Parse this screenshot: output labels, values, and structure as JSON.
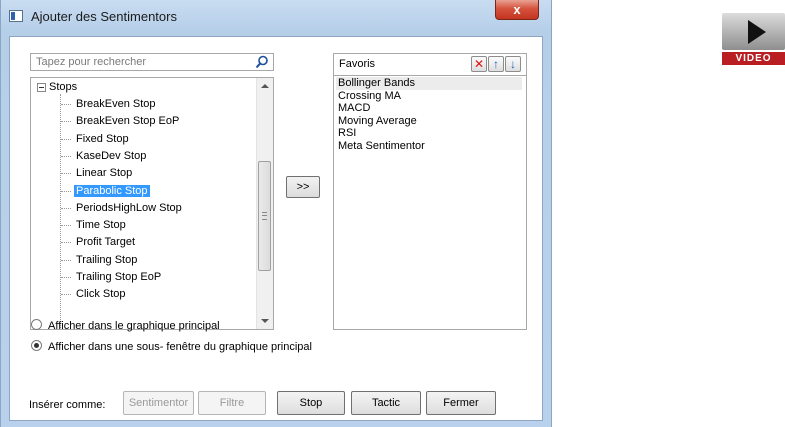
{
  "window": {
    "title": "Ajouter des Sentimentors",
    "close_label": "x"
  },
  "search": {
    "placeholder": "Tapez pour rechercher"
  },
  "tree": {
    "root_label": "Stops",
    "items": [
      {
        "label": "BreakEven Stop"
      },
      {
        "label": "BreakEven Stop EoP"
      },
      {
        "label": "Fixed Stop"
      },
      {
        "label": "KaseDev Stop"
      },
      {
        "label": "Linear Stop"
      },
      {
        "label": "Parabolic Stop",
        "selected": true
      },
      {
        "label": "PeriodsHighLow Stop"
      },
      {
        "label": "Time Stop"
      },
      {
        "label": "Profit Target"
      },
      {
        "label": "Trailing Stop"
      },
      {
        "label": "Trailing Stop EoP"
      },
      {
        "label": "Click Stop"
      }
    ]
  },
  "move_button_label": ">>",
  "favorites": {
    "title": "Favoris",
    "items": [
      {
        "label": "Bollinger Bands"
      },
      {
        "label": "Crossing MA"
      },
      {
        "label": "MACD"
      },
      {
        "label": "Moving Average"
      },
      {
        "label": "RSI"
      },
      {
        "label": "Meta Sentimentor"
      }
    ]
  },
  "display_options": [
    {
      "label": "Afficher dans le graphique principal",
      "checked": false
    },
    {
      "label": "Afficher dans une sous- fenêtre du graphique principal",
      "checked": true
    }
  ],
  "insert_as": {
    "label": "Insérer comme:",
    "buttons": [
      {
        "label": "Sentimentor",
        "enabled": false
      },
      {
        "label": "Filtre",
        "enabled": false
      },
      {
        "label": "Stop",
        "enabled": true
      },
      {
        "label": "Tactic",
        "enabled": true
      }
    ]
  },
  "close_button_label": "Fermer",
  "video_badge": {
    "label": "VIDEO"
  },
  "colors": {
    "selection": "#3399ff",
    "delete_icon": "#dd1111",
    "arrow_icon": "#1f5fbf",
    "video_badge": "#b81e22"
  }
}
